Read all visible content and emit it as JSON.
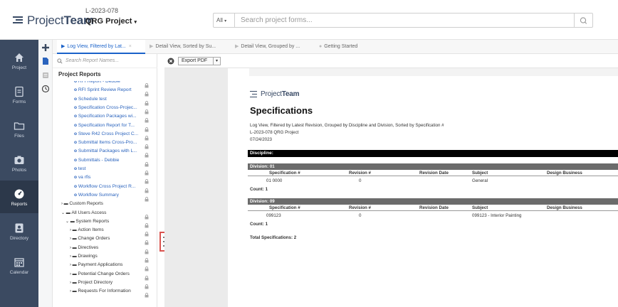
{
  "header": {
    "logo_text_light": "Project",
    "logo_text_bold": "Team",
    "project_code": "L-2023-078",
    "project_name": "QRG Project",
    "search_scope": "All",
    "search_placeholder": "Search project forms..."
  },
  "leftnav": [
    {
      "label": "Project",
      "icon": "home-icon"
    },
    {
      "label": "Forms",
      "icon": "form-icon"
    },
    {
      "label": "Files",
      "icon": "folder-icon"
    },
    {
      "label": "Photos",
      "icon": "camera-icon"
    },
    {
      "label": "Reports",
      "icon": "dashboard-icon",
      "active": true
    },
    {
      "label": "Directory",
      "icon": "contact-icon"
    },
    {
      "label": "Calendar",
      "icon": "calendar-icon"
    }
  ],
  "tabs": [
    {
      "label": "Log View, Filtered by Lat...",
      "active": true
    },
    {
      "label": "Detail View, Sorted by Su..."
    },
    {
      "label": "Detail View, Grouped by ..."
    },
    {
      "label": "Getting Started"
    }
  ],
  "panel": {
    "search_placeholder": "Search Report Names...",
    "title": "Project Reports",
    "rows": [
      {
        "label": "RFI Report - Debbie",
        "type": "report"
      },
      {
        "label": "RFI Sprint Review Report",
        "type": "report"
      },
      {
        "label": "Schedule test",
        "type": "report"
      },
      {
        "label": "Specification Cross-Projec...",
        "type": "report"
      },
      {
        "label": "Specification Packages wi...",
        "type": "report"
      },
      {
        "label": "Specification Report for T...",
        "type": "report"
      },
      {
        "label": "Steve R42 Cross Project C...",
        "type": "report"
      },
      {
        "label": "Submittal Items Cross-Pro...",
        "type": "report"
      },
      {
        "label": "Submittal Packages with L...",
        "type": "report"
      },
      {
        "label": "Submittals - Debbie",
        "type": "report"
      },
      {
        "label": "test",
        "type": "report"
      },
      {
        "label": "va rfis",
        "type": "report"
      },
      {
        "label": "Workflow Cross Project R...",
        "type": "report"
      },
      {
        "label": "Workflow Summary",
        "type": "report"
      },
      {
        "label": "Custom Reports",
        "type": "folder"
      },
      {
        "label": "All Users Access",
        "type": "folder"
      },
      {
        "label": "System Reports",
        "type": "folder"
      },
      {
        "label": "Action Items",
        "type": "folder"
      },
      {
        "label": "Change Orders",
        "type": "folder"
      },
      {
        "label": "Directives",
        "type": "folder"
      },
      {
        "label": "Drawings",
        "type": "folder"
      },
      {
        "label": "Payment Applications",
        "type": "folder"
      },
      {
        "label": "Potential Change Orders",
        "type": "folder"
      },
      {
        "label": "Project Directory",
        "type": "folder"
      },
      {
        "label": "Requests For Information",
        "type": "folder"
      }
    ]
  },
  "toolbar": {
    "export_label": "Export PDF",
    "dropdown_glyph": "▾"
  },
  "document": {
    "logo_light": "Project",
    "logo_bold": "Team",
    "title": "Specifications",
    "subtitle": "Log View, Filtered by Latest Revision, Grouped by Discipline and Division, Sorted by Specification #",
    "project": "L-2023-078 QRG Project",
    "date": "07/24/2023",
    "discipline_label": "Discipline:",
    "columns": [
      "Specification #",
      "Revision #",
      "Revision Date",
      "Subject",
      "Design Business"
    ],
    "divisions": [
      {
        "label": "Division: 01",
        "spec": "01 0000",
        "revision": "0",
        "date": "",
        "subject": "General",
        "count": "Count: 1"
      },
      {
        "label": "Division: 09",
        "spec": "099123",
        "revision": "0",
        "date": "",
        "subject": "099123 - Interior Painting",
        "count": "Count: 1"
      }
    ],
    "total": "Total Specifications: 2"
  },
  "colors": {
    "nav_bg": "#3b4a61",
    "accent": "#1a62c9",
    "link": "#2a63bd"
  }
}
